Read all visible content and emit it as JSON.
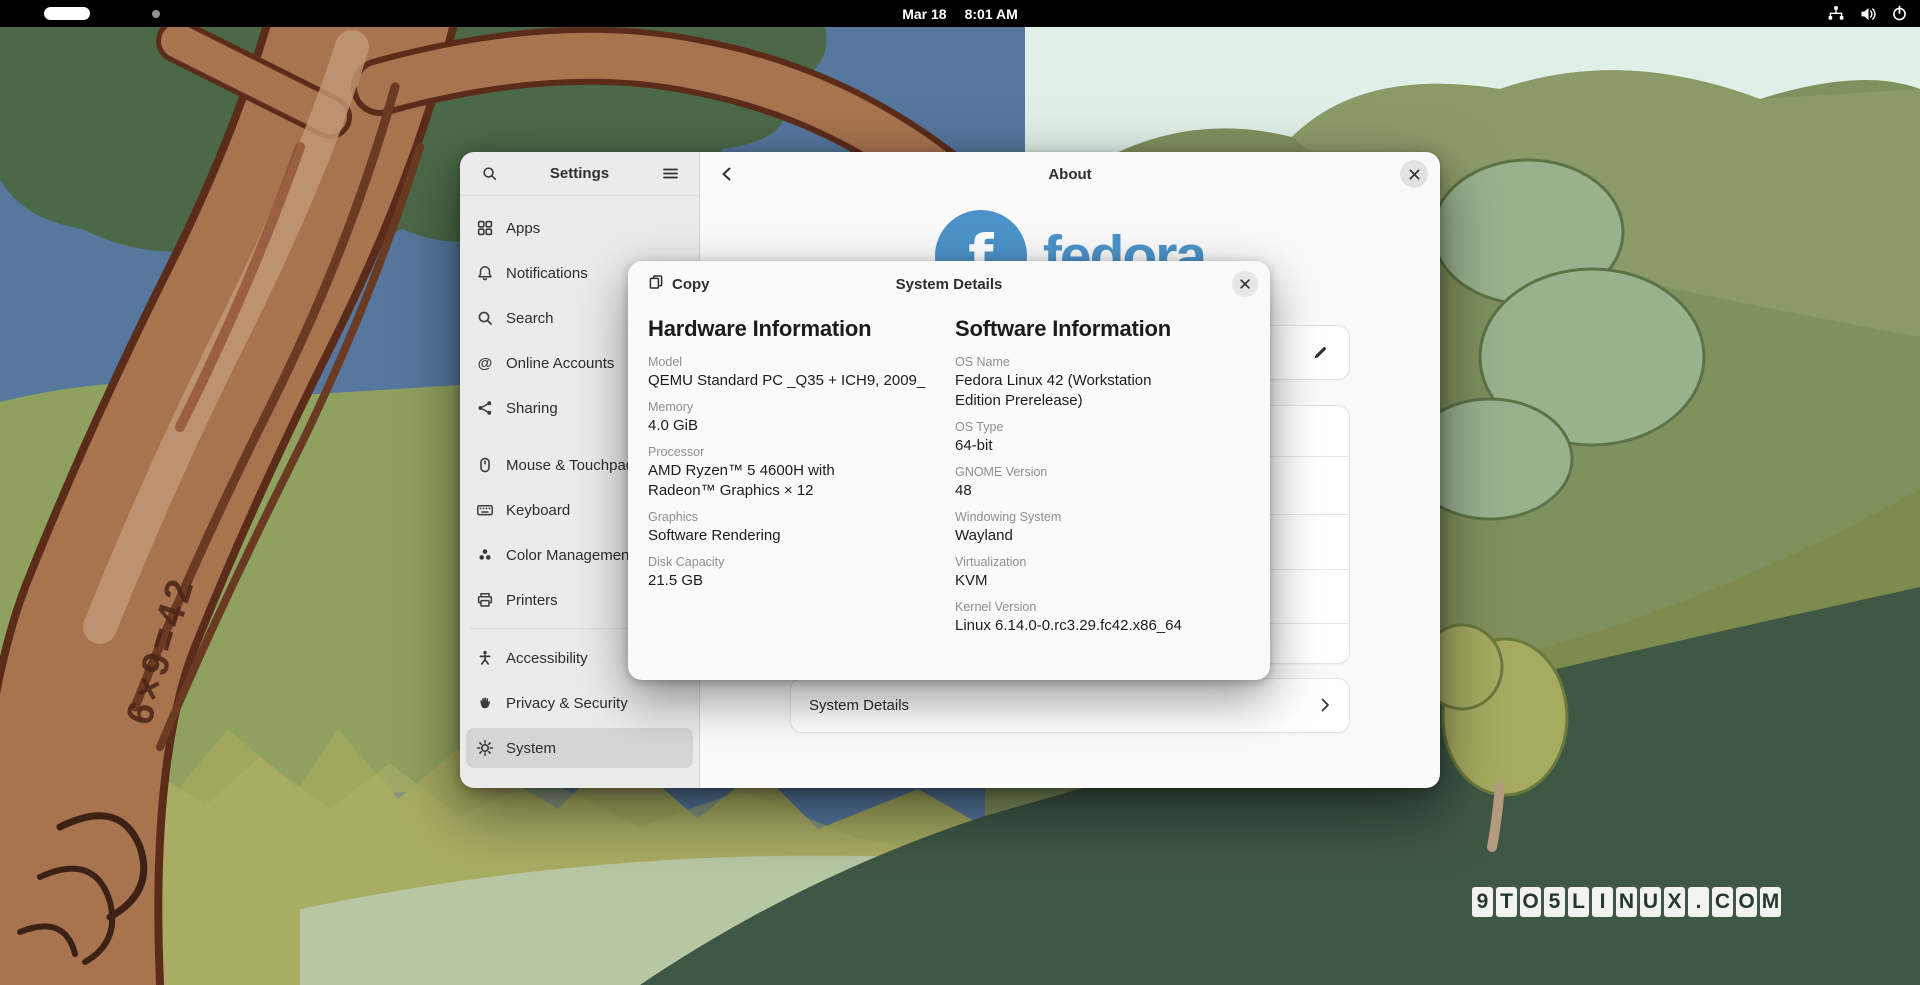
{
  "top_bar": {
    "date": "Mar 18",
    "time": "8:01 AM",
    "left_indicator": "activities-pill",
    "status_icons": [
      "network-wired",
      "volume",
      "power"
    ]
  },
  "settings": {
    "title": "Settings",
    "header_icons": [
      "search",
      "main-menu-hamburger"
    ],
    "sidebar_items": [
      {
        "icon": "apps-grid",
        "label": "Apps"
      },
      {
        "icon": "bell",
        "label": "Notifications"
      },
      {
        "icon": "magnifier",
        "label": "Search"
      },
      {
        "icon": "at-sign",
        "label": "Online Accounts"
      },
      {
        "icon": "share-nodes",
        "label": "Sharing"
      },
      {
        "icon": "mouse",
        "label": "Mouse & Touchpad"
      },
      {
        "icon": "keyboard",
        "label": "Keyboard"
      },
      {
        "icon": "color-circles",
        "label": "Color Management"
      },
      {
        "icon": "printer",
        "label": "Printers"
      },
      {
        "icon": "accessibility-person",
        "label": "Accessibility"
      },
      {
        "icon": "hand",
        "label": "Privacy & Security"
      },
      {
        "icon": "gear",
        "label": "System"
      }
    ],
    "selected_item": "System"
  },
  "about_page": {
    "title": "About",
    "logo_glyph": "f",
    "logo_wordmark": "fedora",
    "system_details_row_label": "System Details"
  },
  "dialog": {
    "title": "System Details",
    "copy_button_label": "Copy",
    "hardware": {
      "heading": "Hardware Information",
      "fields": [
        {
          "label": "Model",
          "value": "QEMU Standard PC _Q35 + ICH9, 2009_"
        },
        {
          "label": "Memory",
          "value": "4.0 GiB"
        },
        {
          "label": "Processor",
          "value": "AMD Ryzen™ 5 4600H with Radeon™ Graphics × 12"
        },
        {
          "label": "Graphics",
          "value": "Software Rendering"
        },
        {
          "label": "Disk Capacity",
          "value": "21.5 GB"
        }
      ]
    },
    "software": {
      "heading": "Software Information",
      "fields": [
        {
          "label": "OS Name",
          "value": "Fedora Linux 42 (Workstation Edition Prerelease)"
        },
        {
          "label": "OS Type",
          "value": "64-bit"
        },
        {
          "label": "GNOME Version",
          "value": "48"
        },
        {
          "label": "Windowing System",
          "value": "Wayland"
        },
        {
          "label": "Virtualization",
          "value": "KVM"
        },
        {
          "label": "Kernel Version",
          "value": "Linux 6.14.0-0.rc3.29.fc42.x86_64"
        }
      ]
    }
  },
  "watermark": {
    "text": "9TO5LINUX.COM"
  },
  "colors": {
    "accent_blue": "#4c93c9",
    "topbar_bg": "#010101",
    "sidebar_bg": "#ebebeb",
    "content_bg": "#fafafa",
    "selected_row_bg": "#d5d5d5",
    "watermark_text": "#24392c"
  }
}
